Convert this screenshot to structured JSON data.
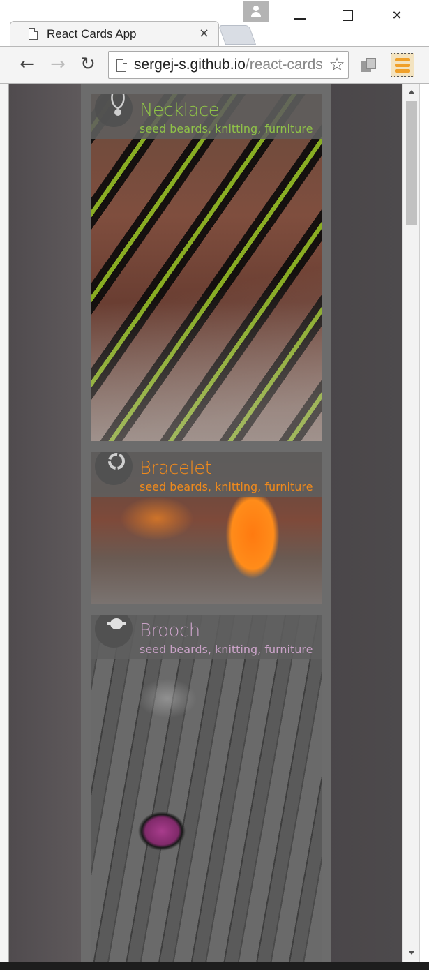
{
  "browser": {
    "tab_title": "React Cards App",
    "tab_close": "×",
    "url_host": "sergej-s.github.io",
    "url_path": "/react-cards",
    "nav": {
      "back": "←",
      "forward": "→",
      "reload": "↻"
    },
    "window_controls": {
      "close": "✕"
    },
    "star": "☆"
  },
  "colors": {
    "necklace_accent": "#8fc248",
    "bracelet_accent": "#f08a1c",
    "brooch_accent": "#c9a2c7"
  },
  "cards": [
    {
      "title": "Necklace",
      "subtitle": "seed beards, knitting, furniture",
      "icon": "necklace-icon"
    },
    {
      "title": "Bracelet",
      "subtitle": "seed beards, knitting, furniture",
      "icon": "bracelet-icon"
    },
    {
      "title": "Brooch",
      "subtitle": "seed beards, knitting, furniture",
      "icon": "brooch-icon"
    }
  ]
}
